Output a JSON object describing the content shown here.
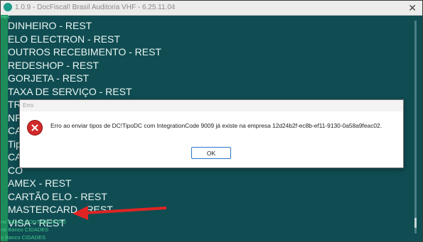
{
  "window": {
    "title": "1.0.9 - DocFiscal! Brasil Auditoria VHF - 6.25.11.04",
    "side_label": "Hes"
  },
  "list_items": [
    "DINHEIRO - REST",
    "ELO ELECTRON - REST",
    "OUTROS RECEBIMENTO - REST",
    "REDESHOP - REST",
    "GORJETA - REST",
    "TAXA DE SERVIÇO - REST",
    "TROCO - REST",
    "NF",
    "CA",
    "Tip",
    "CA",
    "CO",
    "AMEX - REST",
    "CARTÃO ELO - REST",
    "MASTERCARD - REST",
    "VISA - REST"
  ],
  "background_log": [
    "no Banco CONTABILISTAS",
    "no Banco CIDADES",
    "o Banco CIDADES"
  ],
  "dialog": {
    "title": "Erro",
    "message": "Erro ao enviar tipos de DC!TipoDC com IntegrationCode 9009 já existe na empresa 12d24b2f-ec8b-ef11-9130-0a58a9feac02.",
    "ok_label": "OK"
  },
  "colors": {
    "window_bg": "#0f4d52",
    "error_red": "#d12a2a",
    "arrow_red": "#e02424",
    "ok_border": "#2c76c9"
  }
}
